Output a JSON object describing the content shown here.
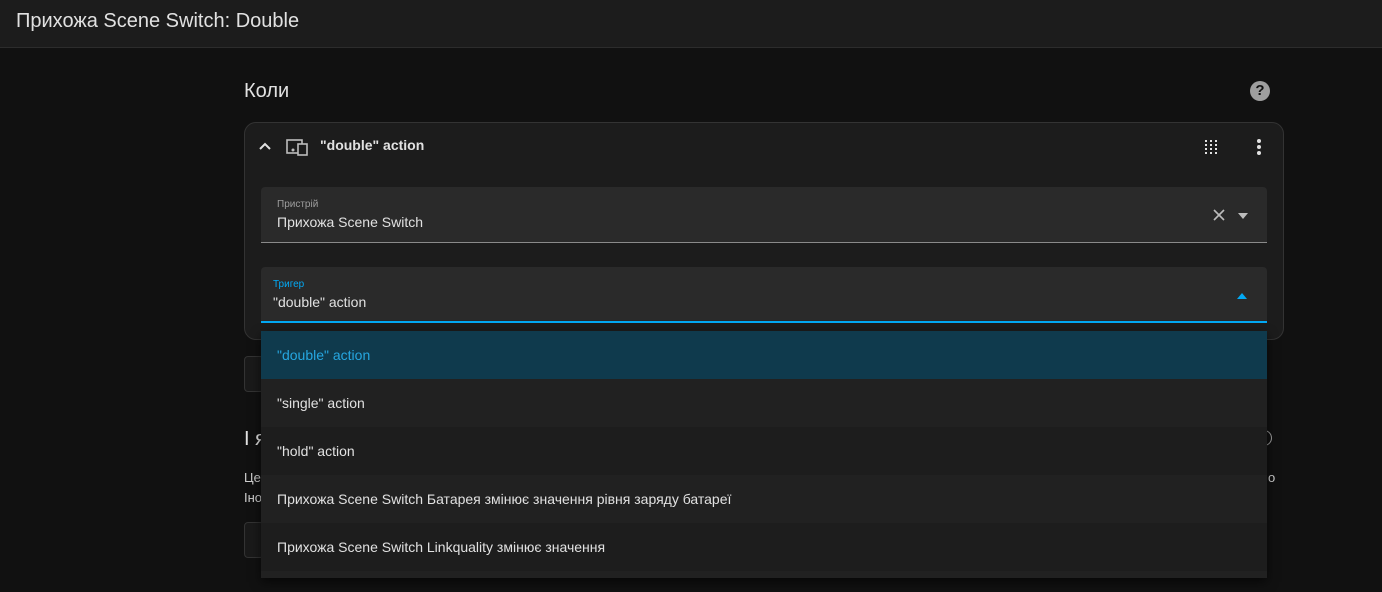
{
  "header": {
    "title": "Прихожа Scene Switch: Double"
  },
  "section": {
    "title": "Коли",
    "help_icon": "help-circle-icon"
  },
  "trigger_card": {
    "title": "\"double\" action",
    "icons": [
      "chevron-up-icon",
      "device-icon",
      "drag-handle-icon",
      "more-vert-icon"
    ],
    "device_field": {
      "label": "Пристрій",
      "value": "Прихожа Scene Switch"
    },
    "trigger_field": {
      "label": "Тригер",
      "value": "\"double\" action"
    }
  },
  "background": {
    "heading_fragment": "І я",
    "text_fragment_1": "Це",
    "text_fragment_2": "Іно",
    "text_fragment_right": "о"
  },
  "dropdown": {
    "options": [
      "\"double\" action",
      "\"single\" action",
      "\"hold\" action",
      "Прихожа Scene Switch Батарея змінює значення рівня заряду батареї",
      "Прихожа Scene Switch Linkquality змінює значення"
    ],
    "selected": "\"double\" action"
  },
  "colors": {
    "accent": "#03a9f4",
    "selected_bg": "#0f3a4d",
    "background": "#111111"
  }
}
